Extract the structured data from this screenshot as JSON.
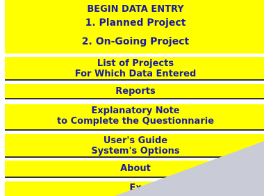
{
  "menu": {
    "begin_data_entry": {
      "header": "BEGIN DATA ENTRY",
      "option_1": "1. Planned Project",
      "option_2": "2. On-Going Project"
    },
    "list_of_projects": {
      "line_1": "List of Projects",
      "line_2": "For Which Data Entered"
    },
    "reports": {
      "label": "Reports"
    },
    "explanatory_note": {
      "line_1": "Explanatory Note",
      "line_2": "to Complete the Questionnarie"
    },
    "users_guide": {
      "line_1": "User's Guide",
      "line_2": "System's Options"
    },
    "about": {
      "label": "About"
    },
    "exit": {
      "label": "Ex"
    }
  },
  "colors": {
    "button_fill": "#ffff00",
    "text": "#1a1aa0",
    "divider": "#2f2f2f",
    "page_curl": "#c9cbd6"
  },
  "icons": {
    "page_curl": "page-curl-overlay"
  }
}
